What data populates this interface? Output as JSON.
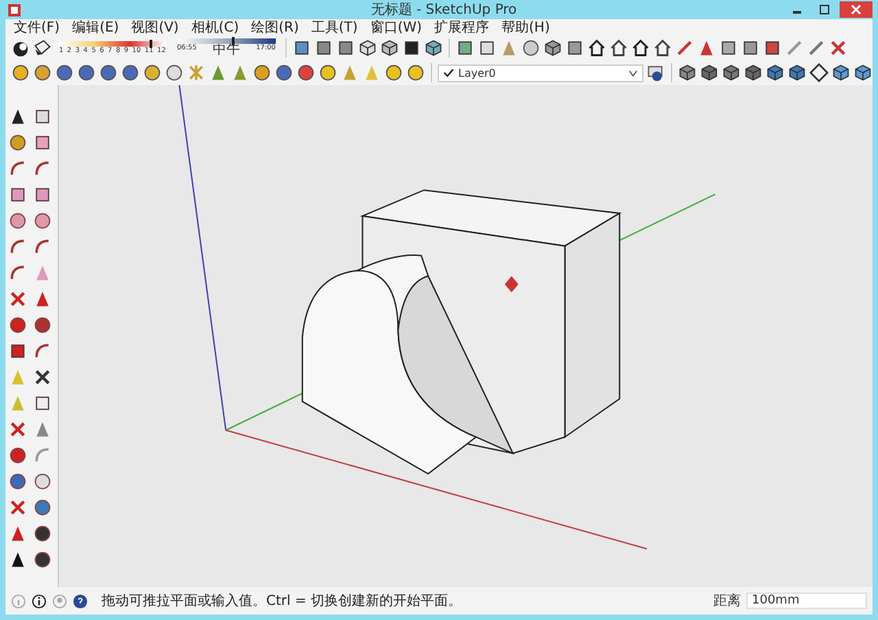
{
  "window": {
    "title": "无标题 - SketchUp Pro"
  },
  "menu": [
    "文件(F)",
    "编辑(E)",
    "视图(V)",
    "相机(C)",
    "绘图(R)",
    "工具(T)",
    "窗口(W)",
    "扩展程序",
    "帮助(H)"
  ],
  "shadow_settings": {
    "month_slider": {
      "level": 0.85
    },
    "time_slider": {
      "level": 0.55
    },
    "month_labels": [
      "1",
      "2",
      "3",
      "4",
      "5",
      "6",
      "7",
      "8",
      "9",
      "10",
      "11",
      "12"
    ],
    "time_start": "06:55",
    "time_mid": "中午",
    "time_end": "17:00"
  },
  "layer_dropdown": {
    "value": "Layer0",
    "checked": true
  },
  "status_bar": {
    "message": "拖动可推拉平面或输入值。Ctrl = 切换创建新的开始平面。",
    "measurement_label": "距离",
    "measurement_value": "100mm"
  }
}
